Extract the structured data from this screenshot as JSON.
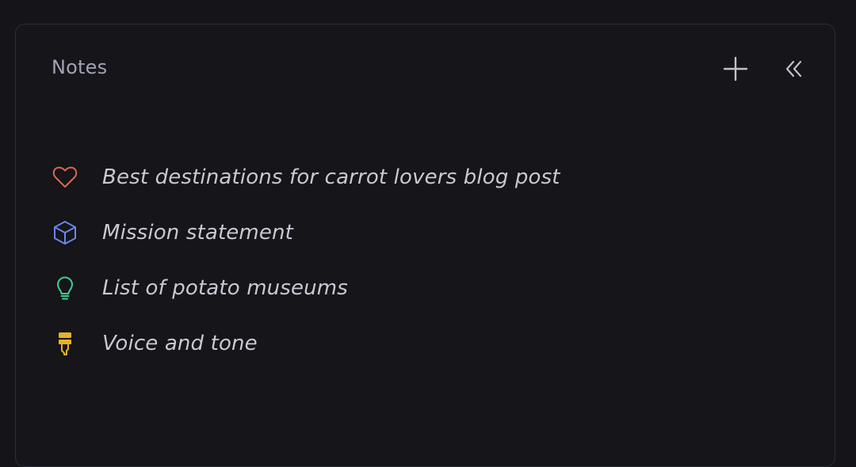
{
  "panel": {
    "title": "Notes",
    "add_icon": "plus-icon",
    "collapse_icon": "chevrons-left-icon"
  },
  "notes": [
    {
      "label": "Best destinations for carrot lovers blog post",
      "icon": "heart-icon",
      "color": "#e0664f"
    },
    {
      "label": "Mission statement",
      "icon": "cube-icon",
      "color": "#6b86e8"
    },
    {
      "label": "List of potato museums",
      "icon": "lightbulb-icon",
      "color": "#3fcf8e"
    },
    {
      "label": "Voice and tone",
      "icon": "brush-icon",
      "color": "#e6b12a"
    }
  ]
}
